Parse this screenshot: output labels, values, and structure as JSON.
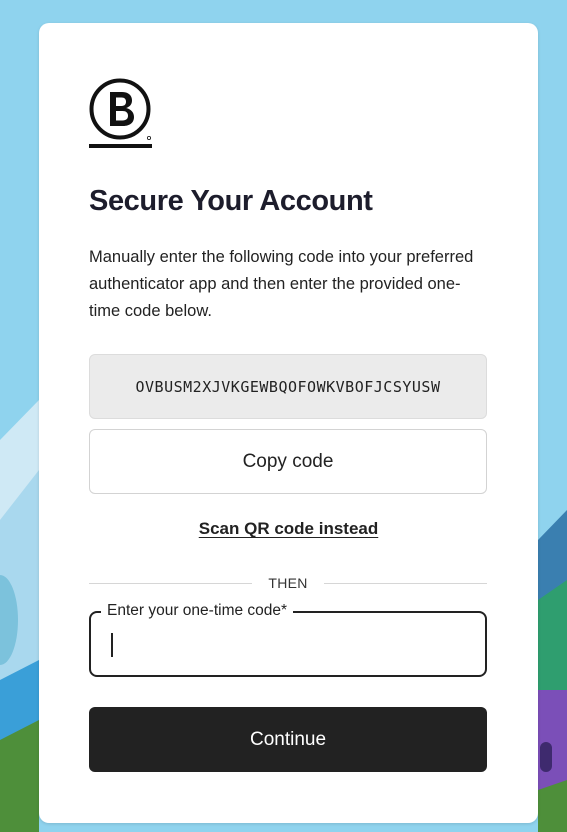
{
  "header": {
    "title": "Secure Your Account"
  },
  "instructions": "Manually enter the following code into your preferred authenticator app and then enter the provided one-time code below.",
  "secret_code": "OVBUSM2XJVKGEWBQOFOWKVBOFJCSYUSW",
  "buttons": {
    "copy_label": "Copy code",
    "scan_qr_label": "Scan QR code instead",
    "continue_label": "Continue"
  },
  "divider_label": "THEN",
  "otp_field": {
    "label": "Enter your one-time code*",
    "value": ""
  },
  "colors": {
    "primary_button": "#222222",
    "background_sky": "#8fd3ee",
    "code_box": "#ebebeb"
  },
  "icons": {
    "logo": "b-corp-logo-icon"
  }
}
